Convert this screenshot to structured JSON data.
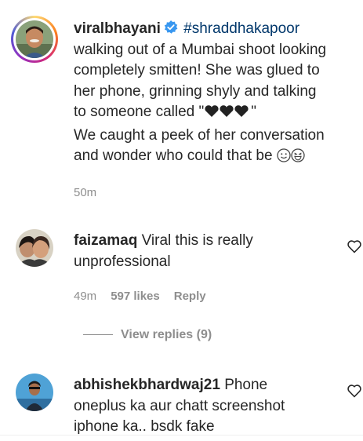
{
  "post": {
    "username": "viralbhayani",
    "hashtag": "#shraddhakapoor",
    "lines": [
      "walking out of a Mumbai shoot looking",
      "completely smitten! She was glued to",
      "her phone, grinning shyly and talking",
      "to someone called \"",
      "We caught a peek of her conversation",
      "and wonder who could that be"
    ],
    "hearts_close_quote": "\"",
    "time": "50m"
  },
  "comments": [
    {
      "username": "faizamaq",
      "text_line1": "Viral this is really",
      "text_line2": "unprofessional",
      "time": "49m",
      "likes": "597 likes",
      "reply_label": "Reply",
      "view_replies": "View replies (9)"
    },
    {
      "username": "abhishekbhardwaj21",
      "text_line1": "Phone",
      "text_line2": "oneplus ka aur chatt screenshot",
      "text_line3": "iphone ka.. bsdk fake"
    }
  ],
  "icons": {
    "verified": "verified-badge-icon",
    "heart": "heart-outline-icon",
    "black_heart": "black-heart-emoji-icon",
    "smile": "smiling-face-emoji-icon",
    "grin": "grinning-squint-emoji-icon"
  },
  "colors": {
    "text": "#262626",
    "hashtag": "#00376b",
    "verified": "#3897f0",
    "meta": "#8e8e8e"
  }
}
